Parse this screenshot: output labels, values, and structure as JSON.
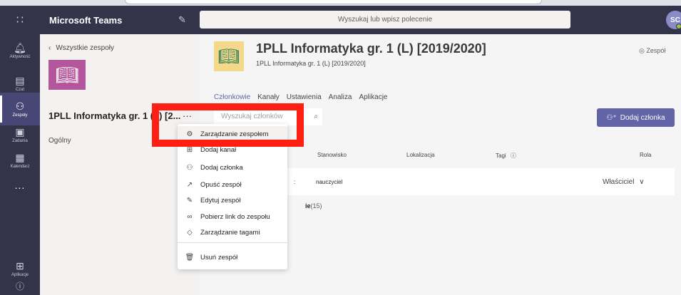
{
  "app": {
    "title": "Microsoft Teams"
  },
  "search": {
    "placeholder": "Wyszukaj lub wpisz polecenie"
  },
  "user": {
    "initials": "SC"
  },
  "rail": {
    "items": [
      {
        "label": "Aktywność",
        "icon": "bell-icon"
      },
      {
        "label": "Czat",
        "icon": "chat-icon"
      },
      {
        "label": "Zespoły",
        "icon": "teams-icon"
      },
      {
        "label": "Zadania",
        "icon": "assignments-icon"
      },
      {
        "label": "Kalendarz",
        "icon": "calendar-icon"
      }
    ],
    "more": "...",
    "apps_label": "Aplikacje",
    "help_icon": "help-icon"
  },
  "teams_pane": {
    "back_label": "Wszystkie zespoły",
    "team_name": "1PLL Informatyka gr. 1 (L) [2...",
    "more": "···",
    "channel": "Ogólny"
  },
  "header": {
    "title": "1PLL Informatyka gr. 1 (L) [2019/2020]",
    "more": "···",
    "subtitle": "1PLL Informatyka gr. 1 (L) [2019/2020]",
    "badge": "Zespół"
  },
  "tabs": [
    "Członkowie",
    "Kanały",
    "Ustawienia",
    "Analiza",
    "Aplikacje"
  ],
  "members": {
    "search_placeholder": "Wyszukaj członków",
    "add_label": "Dodaj członka",
    "columns": {
      "position": "Stanowisko",
      "location": "Lokalizacja",
      "tags": "Tagi",
      "role": "Rola"
    },
    "owner_row": {
      "name_tail": ":",
      "position": "nauczyciel",
      "role": "Właściciel"
    },
    "students": {
      "label": "ie",
      "count": "(15)"
    }
  },
  "context_menu": {
    "items": [
      {
        "label": "Zarządzanie zespołem",
        "icon": "gear-icon"
      },
      {
        "label": "Dodaj kanał",
        "icon": "add-channel-icon"
      },
      {
        "label": "Dodaj członka",
        "icon": "add-person-icon"
      },
      {
        "label": "Opuść zespół",
        "icon": "leave-icon"
      },
      {
        "label": "Edytuj zespół",
        "icon": "pencil-icon"
      },
      {
        "label": "Pobierz link do zespołu",
        "icon": "link-icon"
      },
      {
        "label": "Zarządzanie tagami",
        "icon": "tag-icon"
      },
      {
        "label": "Usuń zespół",
        "icon": "trash-icon"
      }
    ]
  },
  "colors": {
    "accent": "#6264a7",
    "rail": "#33344a",
    "highlight": "#ff1f12",
    "team_logo": "#b4569b"
  }
}
